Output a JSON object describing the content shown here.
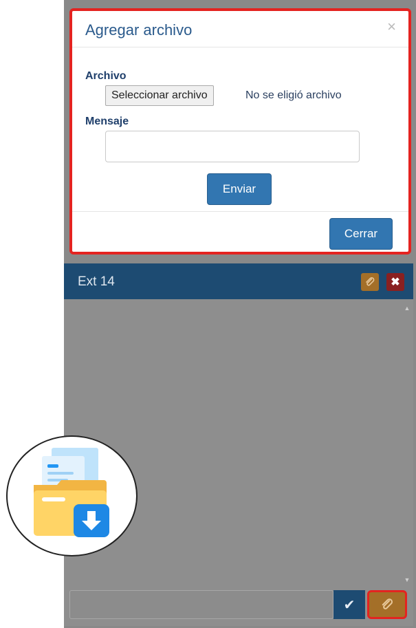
{
  "modal": {
    "title": "Agregar archivo",
    "close_symbol": "×",
    "file_label": "Archivo",
    "file_button": "Seleccionar archivo",
    "file_status": "No se eligió archivo",
    "message_label": "Mensaje",
    "message_value": "",
    "send_button": "Enviar",
    "close_button": "Cerrar"
  },
  "chat": {
    "title": "Ext 14",
    "close_symbol": "✖",
    "send_symbol": "✔",
    "input_value": ""
  },
  "icons": {
    "modal_close": "close-icon",
    "header_attach": "paperclip-icon",
    "header_close": "close-icon",
    "send": "checkmark-icon",
    "attach": "paperclip-icon",
    "scroll_up": "caret-up-icon",
    "scroll_down": "caret-down-icon",
    "illustration": "folder-download-icon"
  },
  "colors": {
    "highlight": "#e42320",
    "primary": "#3276b1",
    "chat_header": "#1d4b72",
    "attach": "#a46f28",
    "danger": "#8a2020"
  }
}
